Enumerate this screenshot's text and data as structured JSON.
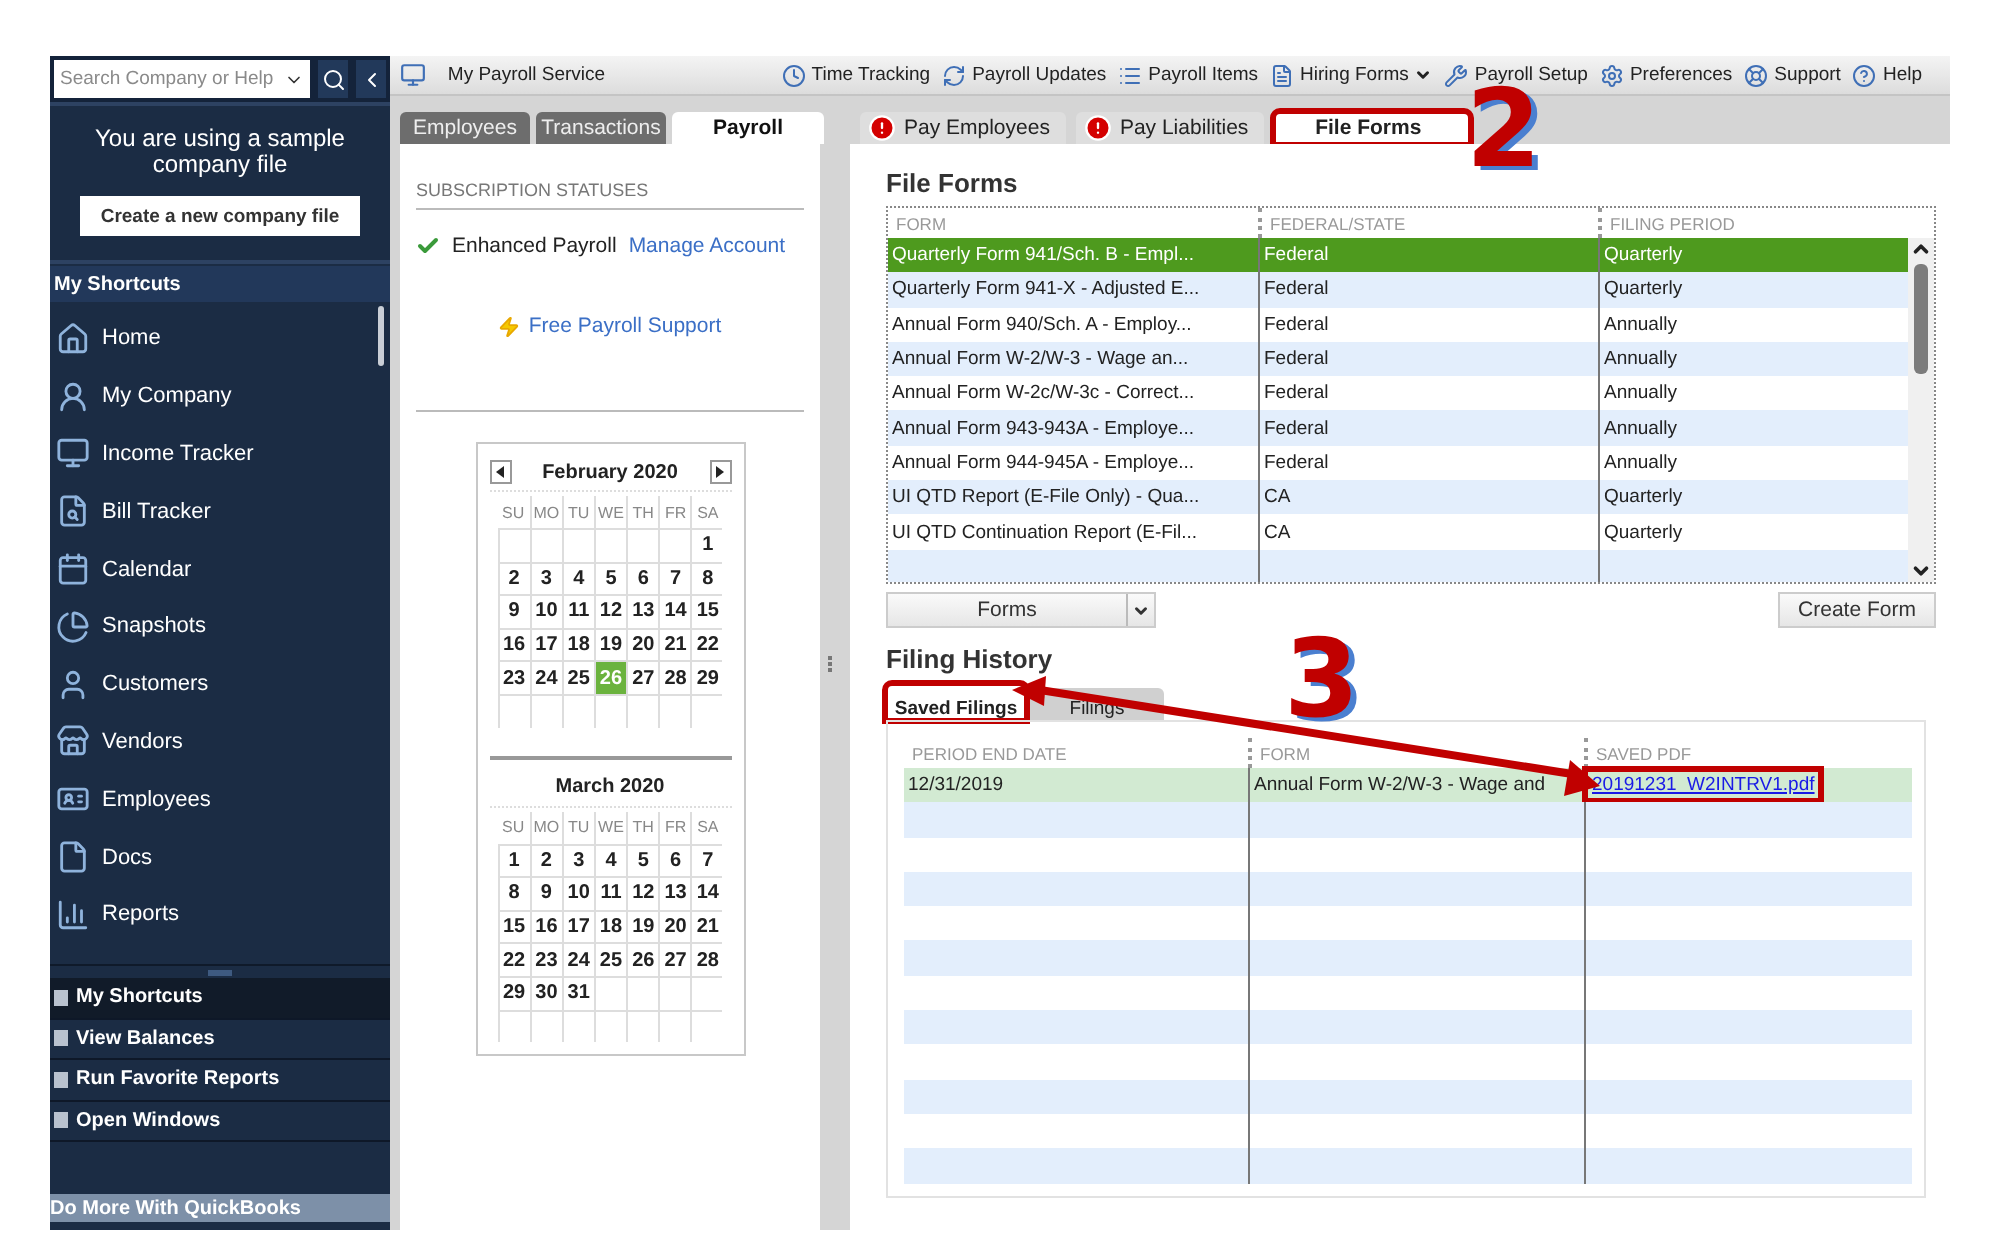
{
  "sidebar": {
    "search": {
      "placeholder": "Search Company or Help"
    },
    "notice": "You are using a sample company file",
    "create_button": "Create a new company file",
    "shortcuts_header": "My Shortcuts",
    "items": [
      {
        "label": "Home"
      },
      {
        "label": "My Company"
      },
      {
        "label": "Income Tracker"
      },
      {
        "label": "Bill Tracker"
      },
      {
        "label": "Calendar"
      },
      {
        "label": "Snapshots"
      },
      {
        "label": "Customers"
      },
      {
        "label": "Vendors"
      },
      {
        "label": "Employees"
      },
      {
        "label": "Docs"
      },
      {
        "label": "Reports"
      }
    ],
    "panels": [
      {
        "label": "My Shortcuts",
        "selected": true
      },
      {
        "label": "View Balances",
        "selected": false
      },
      {
        "label": "Run Favorite Reports",
        "selected": false
      },
      {
        "label": "Open Windows",
        "selected": false
      }
    ],
    "footer": "Do More With QuickBooks"
  },
  "toolbar": {
    "service": "My Payroll Service",
    "items": [
      {
        "label": "Time Tracking",
        "dropdown": false
      },
      {
        "label": "Payroll Updates",
        "dropdown": false
      },
      {
        "label": "Payroll Items",
        "dropdown": false
      },
      {
        "label": "Hiring Forms",
        "dropdown": true
      },
      {
        "label": "Payroll Setup",
        "dropdown": false
      },
      {
        "label": "Preferences",
        "dropdown": false
      },
      {
        "label": "Support",
        "dropdown": false
      },
      {
        "label": "Help",
        "dropdown": false
      }
    ]
  },
  "left_tabs": [
    {
      "label": "Employees",
      "selected": false
    },
    {
      "label": "Transactions",
      "selected": false
    },
    {
      "label": "Payroll",
      "selected": true
    }
  ],
  "subscription": {
    "heading": "SUBSCRIPTION STATUSES",
    "service": "Enhanced Payroll",
    "active": true,
    "link": "Manage Account",
    "support_link": "Free Payroll Support"
  },
  "calendar": [
    {
      "title": "February 2020",
      "nav": true,
      "weekdays": [
        "SU",
        "MO",
        "TU",
        "WE",
        "TH",
        "FR",
        "SA"
      ],
      "weeks": [
        [
          {
            "kind": "blank"
          },
          {
            "kind": "blank"
          },
          {
            "kind": "blank"
          },
          {
            "kind": "blank"
          },
          {
            "kind": "blank"
          },
          {
            "kind": "blank"
          },
          {
            "kind": "day",
            "day": "1",
            "selected": false
          }
        ],
        [
          {
            "day": "2",
            "selected": false
          },
          {
            "day": "3",
            "selected": false
          },
          {
            "day": "4",
            "selected": false
          },
          {
            "day": "5",
            "selected": false
          },
          {
            "day": "6",
            "selected": false
          },
          {
            "day": "7",
            "selected": false
          },
          {
            "day": "8",
            "selected": false
          }
        ],
        [
          {
            "day": "9",
            "selected": false
          },
          {
            "day": "10",
            "selected": false
          },
          {
            "day": "11",
            "selected": false
          },
          {
            "day": "12",
            "selected": false
          },
          {
            "day": "13",
            "selected": false
          },
          {
            "day": "14",
            "selected": false
          },
          {
            "day": "15",
            "selected": false
          }
        ],
        [
          {
            "day": "16",
            "selected": false
          },
          {
            "day": "17",
            "selected": false
          },
          {
            "day": "18",
            "selected": false
          },
          {
            "day": "19",
            "selected": false
          },
          {
            "day": "20",
            "selected": false
          },
          {
            "day": "21",
            "selected": false
          },
          {
            "day": "22",
            "selected": false
          }
        ],
        [
          {
            "day": "23",
            "selected": false
          },
          {
            "day": "24",
            "selected": false
          },
          {
            "day": "25",
            "selected": false
          },
          {
            "day": "26",
            "selected": true
          },
          {
            "day": "27",
            "selected": false
          },
          {
            "day": "28",
            "selected": false
          },
          {
            "day": "29",
            "selected": false
          }
        ]
      ]
    },
    {
      "title": "March 2020",
      "nav": false,
      "weekdays": [
        "SU",
        "MO",
        "TU",
        "WE",
        "TH",
        "FR",
        "SA"
      ],
      "weeks": [
        [
          {
            "day": "1",
            "selected": false
          },
          {
            "day": "2",
            "selected": false
          },
          {
            "day": "3",
            "selected": false
          },
          {
            "day": "4",
            "selected": false
          },
          {
            "day": "5",
            "selected": false
          },
          {
            "day": "6",
            "selected": false
          },
          {
            "day": "7",
            "selected": false
          }
        ],
        [
          {
            "day": "8",
            "selected": false
          },
          {
            "day": "9",
            "selected": false
          },
          {
            "day": "10",
            "selected": false
          },
          {
            "day": "11",
            "selected": false
          },
          {
            "day": "12",
            "selected": false
          },
          {
            "day": "13",
            "selected": false
          },
          {
            "day": "14",
            "selected": false
          }
        ],
        [
          {
            "day": "15",
            "selected": false
          },
          {
            "day": "16",
            "selected": false
          },
          {
            "day": "17",
            "selected": false
          },
          {
            "day": "18",
            "selected": false
          },
          {
            "day": "19",
            "selected": false
          },
          {
            "day": "20",
            "selected": false
          },
          {
            "day": "21",
            "selected": false
          }
        ],
        [
          {
            "day": "22",
            "selected": false
          },
          {
            "day": "23",
            "selected": false
          },
          {
            "day": "24",
            "selected": false
          },
          {
            "day": "25",
            "selected": false
          },
          {
            "day": "26",
            "selected": false
          },
          {
            "day": "27",
            "selected": false
          },
          {
            "day": "28",
            "selected": false
          }
        ],
        [
          {
            "day": "29",
            "selected": false
          },
          {
            "day": "30",
            "selected": false
          },
          {
            "day": "31",
            "selected": false
          },
          {
            "kind": "blank"
          },
          {
            "kind": "blank"
          },
          {
            "kind": "blank"
          },
          {
            "kind": "blank"
          }
        ]
      ]
    }
  ],
  "right_tabs": [
    {
      "label": "Pay Employees",
      "alert": true,
      "selected": false,
      "highlighted": false
    },
    {
      "label": "Pay Liabilities",
      "alert": true,
      "selected": false,
      "highlighted": false
    },
    {
      "label": "File Forms",
      "alert": false,
      "selected": true,
      "highlighted": true
    }
  ],
  "file_forms": {
    "title": "File Forms",
    "columns": [
      "FORM",
      "FEDERAL/STATE",
      "FILING PERIOD"
    ],
    "rows": [
      {
        "form": "Quarterly Form 941/Sch. B - Empl...",
        "jurisdiction": "Federal",
        "period": "Quarterly",
        "selected": true
      },
      {
        "form": "Quarterly Form 941-X - Adjusted E...",
        "jurisdiction": "Federal",
        "period": "Quarterly",
        "selected": false
      },
      {
        "form": "Annual Form 940/Sch. A - Employ...",
        "jurisdiction": "Federal",
        "period": "Annually",
        "selected": false
      },
      {
        "form": "Annual Form W-2/W-3 - Wage an...",
        "jurisdiction": "Federal",
        "period": "Annually",
        "selected": false
      },
      {
        "form": "Annual Form W-2c/W-3c - Correct...",
        "jurisdiction": "Federal",
        "period": "Annually",
        "selected": false
      },
      {
        "form": "Annual Form 943-943A - Employe...",
        "jurisdiction": "Federal",
        "period": "Annually",
        "selected": false
      },
      {
        "form": "Annual Form 944-945A - Employe...",
        "jurisdiction": "Federal",
        "period": "Annually",
        "selected": false
      },
      {
        "form": "UI QTD Report (E-File Only) - Qua...",
        "jurisdiction": "CA",
        "period": "Quarterly",
        "selected": false
      },
      {
        "form": "UI QTD Continuation Report (E-Fil...",
        "jurisdiction": "CA",
        "period": "Quarterly",
        "selected": false
      }
    ],
    "forms_button": "Forms",
    "create_button": "Create Form"
  },
  "filing_history": {
    "title": "Filing History",
    "tabs": [
      {
        "label": "Saved Filings",
        "selected": true,
        "highlighted": true
      },
      {
        "label": "Filings",
        "selected": false,
        "highlighted": false
      }
    ],
    "columns": [
      "PERIOD END DATE",
      "FORM",
      "SAVED PDF"
    ],
    "rows": [
      {
        "date": "12/31/2019",
        "form": "Annual Form W-2/W-3 - Wage and",
        "pdf": "20191231_W2INTRV1.pdf",
        "highlighted": true
      }
    ]
  },
  "annotations": [
    {
      "label": "2"
    },
    {
      "label": "3"
    }
  ]
}
